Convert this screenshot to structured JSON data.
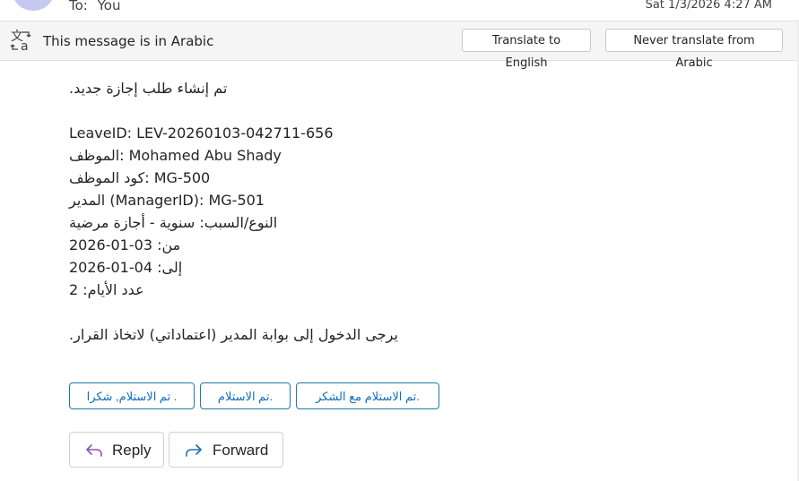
{
  "header": {
    "to_label": "To:",
    "recipient": "You",
    "date": "Sat 1/3/2026 4:27 AM"
  },
  "translation": {
    "message": "This message is in Arabic",
    "translate_button": "Translate to English",
    "never_button": "Never translate from Arabic",
    "icon": "translate-icon"
  },
  "body": {
    "lines": [
      ".تم إنشاء طلب إجازة جديد",
      "LeaveID: LEV-20260103-042711-656",
      "الموظف: Mohamed Abu Shady",
      "كود الموظف: MG-500",
      "المدير (ManagerID): MG-501",
      "النوع/السبب: سنوية - أجازة مرضية",
      "من: 03-01-2026",
      "إلى: 04-01-2026",
      "عدد الأيام: 2",
      ".يرجى الدخول إلى بوابة المدير (اعتماداتي) لاتخاذ القرار"
    ]
  },
  "quick_replies": [
    "تم الاستلام, شكرا .",
    "تم الاستلام.",
    "تم الاستلام مع الشكر."
  ],
  "actions": {
    "reply": "Reply",
    "forward": "Forward"
  },
  "colors": {
    "accent": "#0f6cbd",
    "avatar": "#c5c9ef",
    "bar": "#f5f5f5"
  }
}
